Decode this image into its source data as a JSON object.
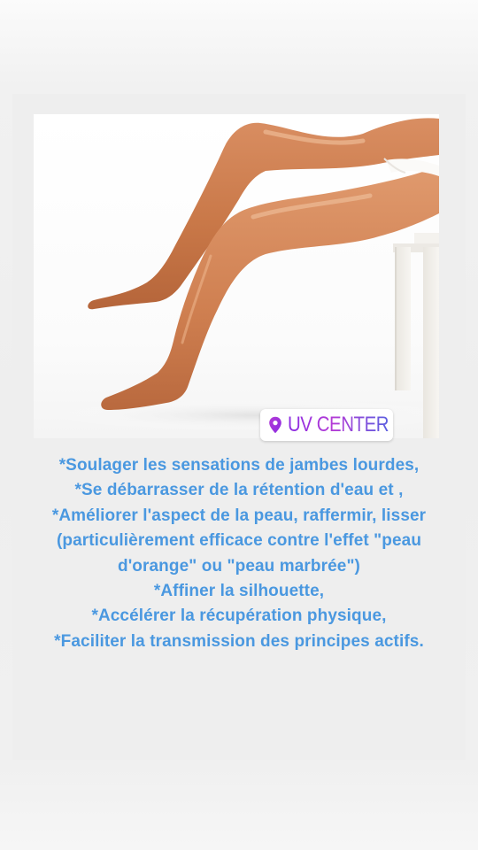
{
  "story": {
    "location_sticker": {
      "label": "UV CENTER",
      "icon": "location-pin-icon",
      "gradient": [
        "#8a2be2",
        "#b43bd6",
        "#5b5fe0"
      ]
    },
    "text_color": "#4a98e0",
    "benefits": [
      "*Soulager les sensations de jambes lourdes,",
      "*Se débarrasser de la rétention d'eau et ,",
      "*Améliorer l'aspect de la peau, raffermir, lisser (particulièrement efficace contre l'effet \"peau d'orange\" ou \"peau marbrée\")",
      "*Affiner la silhouette,",
      "*Accélérer la récupération physique,",
      "*Faciliter la transmission des principes actifs."
    ]
  }
}
